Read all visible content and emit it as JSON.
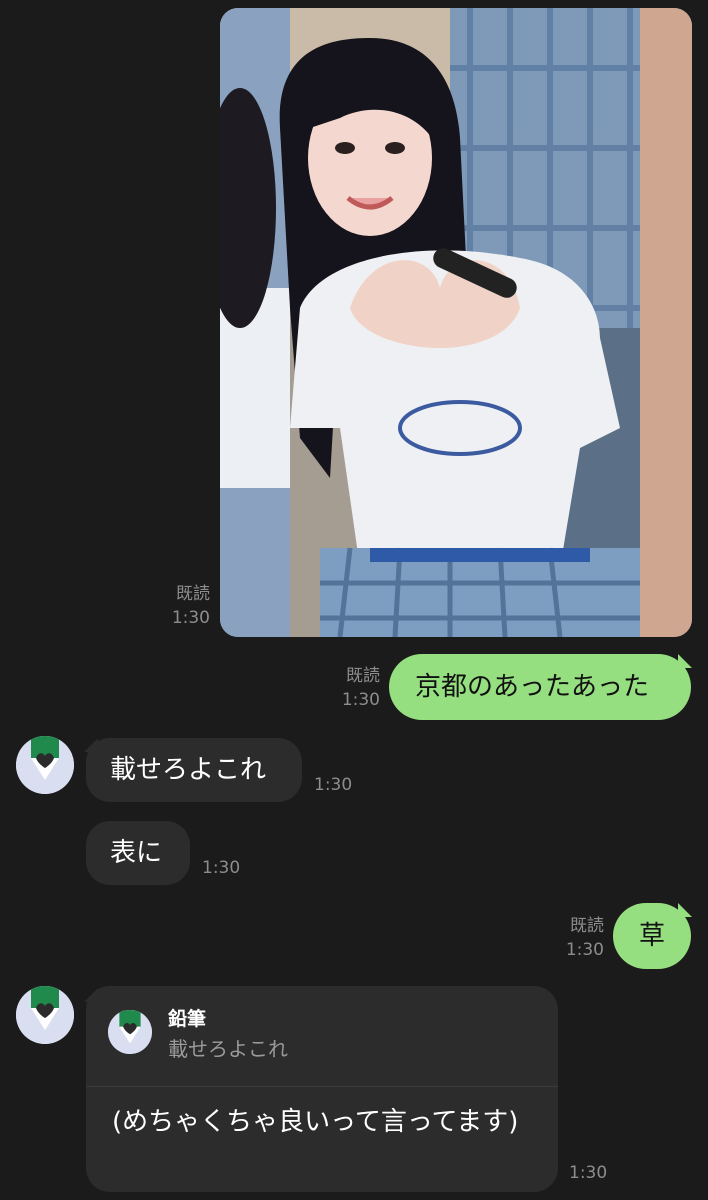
{
  "messages": {
    "photo": {
      "read": "既読",
      "time": "1:30"
    },
    "out1": {
      "text": "京都のあったあった",
      "read": "既読",
      "time": "1:30"
    },
    "in1": {
      "text": "載せろよこれ",
      "time": "1:30"
    },
    "in2": {
      "text": "表に",
      "time": "1:30"
    },
    "out2": {
      "text": "草",
      "read": "既読",
      "time": "1:30"
    },
    "reply": {
      "quoted_name": "鉛筆",
      "quoted_text": "載せろよこれ",
      "text": "(めちゃくちゃ良いって言ってます)",
      "time": "1:30"
    }
  },
  "icons": {
    "avatar": "pencil-avatar-icon"
  },
  "colors": {
    "background": "#1b1b1b",
    "outgoing_bubble": "#96df80",
    "incoming_bubble": "#2c2c2c",
    "meta_text": "#8d8d8d",
    "avatar_green": "#1f8a4c"
  }
}
